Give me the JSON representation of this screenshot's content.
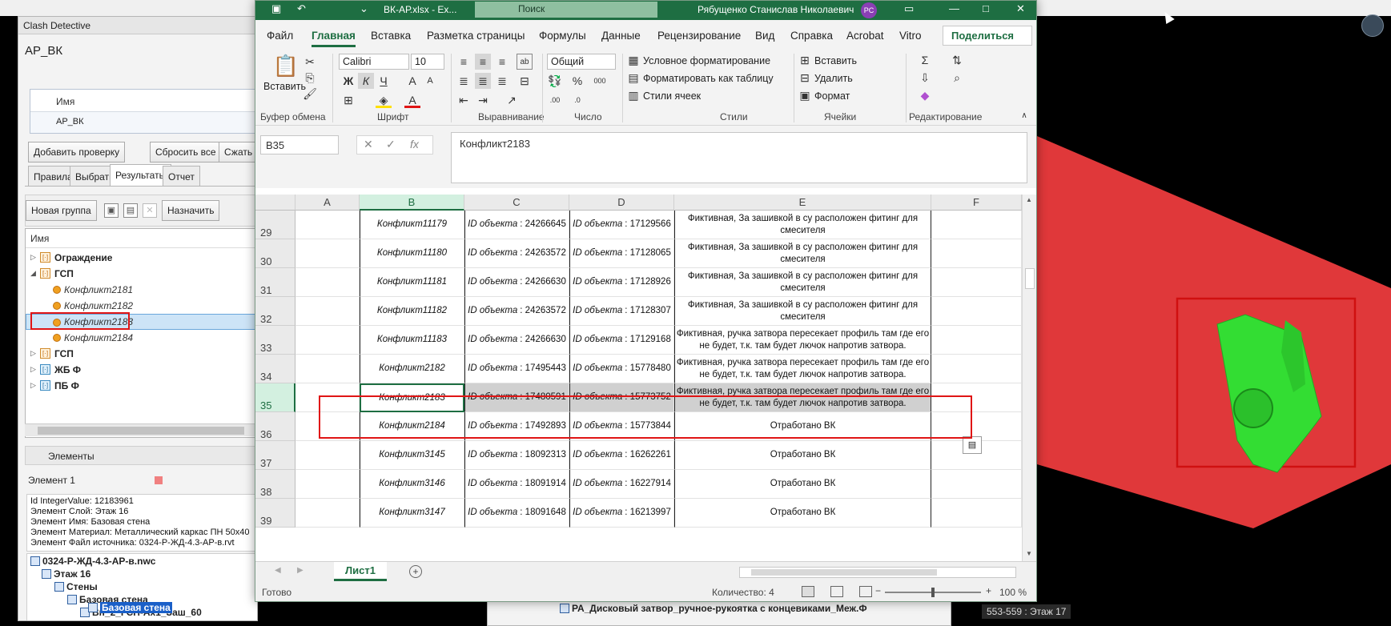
{
  "clash": {
    "panel_title": "Clash Detective",
    "test_name": "АР_ВК",
    "tests_header": "Имя",
    "tests_row": "АР_ВК",
    "btn_add_test": "Добавить проверку",
    "btn_reset_all": "Сбросить все",
    "btn_compact": "Сжать в",
    "tabs": [
      "Правила",
      "Выбрать",
      "Результаты",
      "Отчет"
    ],
    "btn_new_group": "Новая группа",
    "btn_assign": "Назначить",
    "tree_header": "Имя",
    "tree": [
      {
        "label": "Ограждение",
        "type": "group"
      },
      {
        "label": "ГСП",
        "type": "group-open"
      },
      {
        "label": "Конфликт2181",
        "type": "item"
      },
      {
        "label": "Конфликт2182",
        "type": "item"
      },
      {
        "label": "Конфликт2183",
        "type": "item-selected"
      },
      {
        "label": "Конфликт2184",
        "type": "item"
      },
      {
        "label": "ГСП",
        "type": "group"
      },
      {
        "label": "ЖБ Ф",
        "type": "group"
      },
      {
        "label": "ПБ Ф",
        "type": "group"
      }
    ],
    "section_elements": "Элементы",
    "element_label": "Элемент 1",
    "props": [
      "Id IntegerValue: 12183961",
      "Элемент Слой: Этаж 16",
      "Элемент Имя: Базовая стена",
      "Элемент Материал: Металлический каркас ПН 50x40",
      "Элемент Файл источника: 0324-Р-ЖД-4.3-АР-в.rvt"
    ],
    "sel_tree": [
      "0324-Р-ЖД-4.3-АР-в.nwc",
      "Этаж 16",
      "Стены",
      "Базовая стена",
      "Вн_2_ГСП-Ах1_Заш_60",
      "Базовая стена"
    ]
  },
  "bottom": {
    "right_tree": "РА_Дисковый затвор_ручное-рукоятка с концевиками_Меж.Ф",
    "level": "553-559 : Этаж 17"
  },
  "excel": {
    "file_name": "ВК-АР.xlsx - Ex...",
    "search_placeholder": "Поиск",
    "user_name": "Рябущенко Станислав Николаевич",
    "user_initials": "РС",
    "tabs": [
      "Файл",
      "Главная",
      "Вставка",
      "Разметка страницы",
      "Формулы",
      "Данные",
      "Рецензирование",
      "Вид",
      "Справка",
      "Acrobat",
      "Vitro"
    ],
    "share": "Поделиться",
    "ribbon": {
      "paste": "Вставить",
      "font_name": "Calibri",
      "font_size": "10",
      "number_format": "Общий",
      "conditional": "Условное форматирование",
      "format_table": "Форматировать как таблицу",
      "cell_styles": "Стили ячеек",
      "insert": "Вставить",
      "delete": "Удалить",
      "format": "Формат",
      "groups": [
        "Буфер обмена",
        "Шрифт",
        "Выравнивание",
        "Число",
        "Стили",
        "Ячейки",
        "Редактирование"
      ]
    },
    "name_box": "B35",
    "formula": "Конфликт2183",
    "col_headers": [
      "A",
      "B",
      "C",
      "D",
      "E",
      "F"
    ],
    "rows": [
      {
        "num": "29",
        "b": "Конфликт11179",
        "c": "24266645",
        "d": "17129566",
        "e": "Фиктивная, За зашивкой в су расположен фитинг для смесителя"
      },
      {
        "num": "30",
        "b": "Конфликт11180",
        "c": "24263572",
        "d": "17128065",
        "e": "Фиктивная, За зашивкой в су расположен фитинг для смесителя"
      },
      {
        "num": "31",
        "b": "Конфликт11181",
        "c": "24266630",
        "d": "17128926",
        "e": "Фиктивная, За зашивкой в су расположен фитинг для смесителя"
      },
      {
        "num": "32",
        "b": "Конфликт11182",
        "c": "24263572",
        "d": "17128307",
        "e": "Фиктивная, За зашивкой в су расположен фитинг для смесителя"
      },
      {
        "num": "33",
        "b": "Конфликт11183",
        "c": "24266630",
        "d": "17129168",
        "e": "Фиктивная, ручка затвора пересекает профиль там где его не будет, т.к. там будет лючок напротив затвора."
      },
      {
        "num": "34",
        "b": "Конфликт2182",
        "c": "17495443",
        "d": "15778480",
        "e": "Фиктивная, ручка затвора пересекает профиль там где его не будет, т.к. там будет лючок напротив затвора."
      },
      {
        "num": "35",
        "b": "Конфликт2183",
        "c": "17480591",
        "d": "15773752",
        "e": "Фиктивная, ручка затвора пересекает профиль там где его не будет, т.к. там будет лючок напротив затвора."
      },
      {
        "num": "36",
        "b": "Конфликт2184",
        "c": "17492893",
        "d": "15773844",
        "e": "Отработано ВК"
      },
      {
        "num": "37",
        "b": "Конфликт3145",
        "c": "18092313",
        "d": "16262261",
        "e": "Отработано ВК"
      },
      {
        "num": "38",
        "b": "Конфликт3146",
        "c": "18091914",
        "d": "16227914",
        "e": "Отработано ВК"
      },
      {
        "num": "39",
        "b": "Конфликт3147",
        "c": "18091648",
        "d": "16213997",
        "e": "Отработано ВК"
      }
    ],
    "id_label": "ID объекта",
    "sheet_name": "Лист1",
    "status_ready": "Готово",
    "status_count": "Количество: 4",
    "zoom": "100 %"
  },
  "colors": {
    "excel_green": "#1e6e42",
    "highlight_red": "#e01515",
    "scene_red": "#e0383a",
    "clash_green": "#33dd33"
  }
}
